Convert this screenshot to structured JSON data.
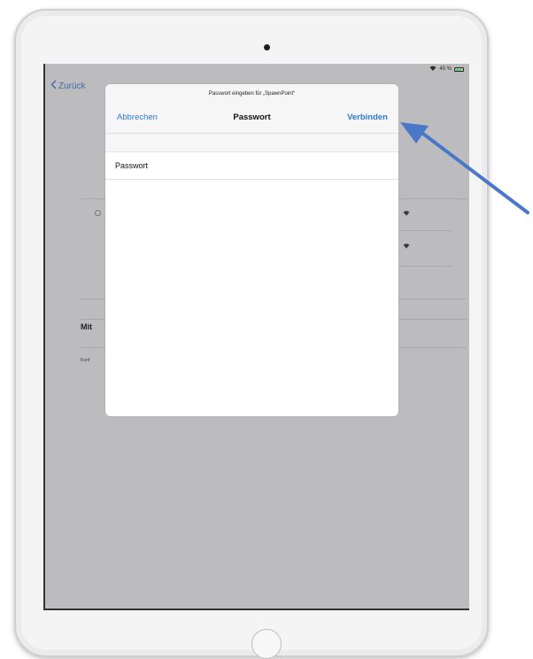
{
  "status_bar": {
    "battery_text": "45 %"
  },
  "nav": {
    "back_label": "Zurück"
  },
  "background": {
    "section_title": "Mit",
    "section_sub": "Konf"
  },
  "dialog": {
    "prompt": "Passwort eingeben für „SpawnPoint“",
    "cancel_label": "Abbrechen",
    "title": "Passwort",
    "connect_label": "Verbinden",
    "password_placeholder": "Passwort",
    "password_value": ""
  },
  "colors": {
    "accent": "#2f7bd8",
    "annotation_arrow": "#4a78c8",
    "battery": "#4cd964"
  },
  "icons": [
    "wifi-icon",
    "battery-icon",
    "chevron-left-icon",
    "arrow-annotation-icon"
  ]
}
